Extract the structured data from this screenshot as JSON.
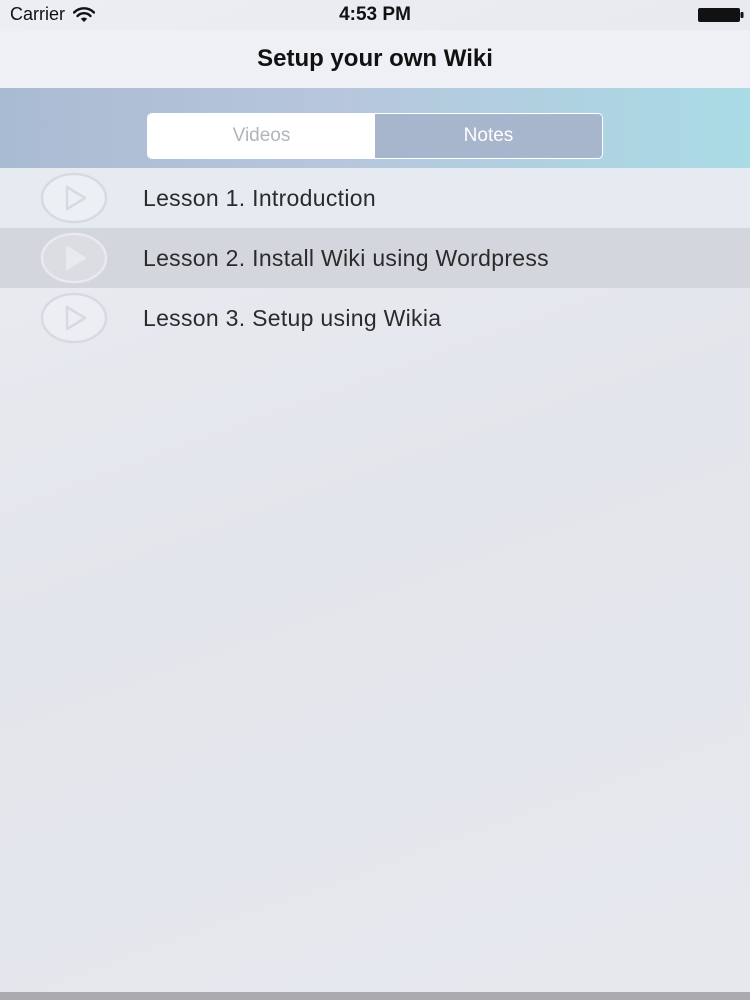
{
  "status_bar": {
    "carrier": "Carrier",
    "time": "4:53 PM"
  },
  "nav": {
    "title": "Setup your own Wiki"
  },
  "segments": [
    {
      "label": "Videos",
      "selected": true
    },
    {
      "label": "Notes",
      "selected": false
    }
  ],
  "lessons": [
    {
      "label": "Lesson 1. Introduction",
      "icon": "play-icon"
    },
    {
      "label": "Lesson 2. Install Wiki using Wordpress",
      "icon": "play-icon"
    },
    {
      "label": "Lesson 3. Setup using Wikia",
      "icon": "play-icon"
    }
  ],
  "colors": {
    "band_start": "#a9bbd2",
    "band_end": "#a9dbe5",
    "highlight_row": "#d3d6dc",
    "segment_selected_bg": "#ffffff",
    "segment_unselected_bg": "#a7b6cd"
  }
}
